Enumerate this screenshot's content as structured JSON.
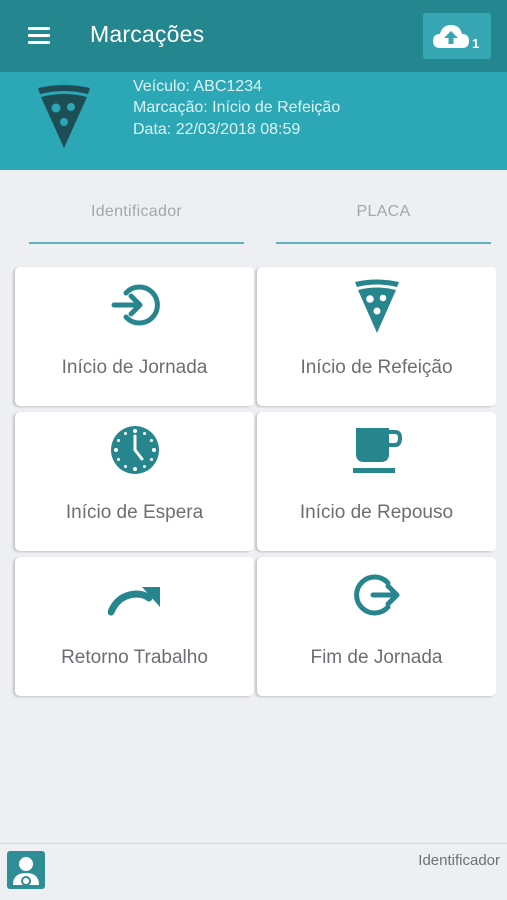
{
  "appbar": {
    "title": "Marcações",
    "upload_count": "1",
    "menu_icon": "menu-icon",
    "upload_icon": "cloud-upload-icon",
    "color": "#24868f"
  },
  "banner": {
    "icon": "pizza-slice-icon",
    "vehicle": "Veículo: ABC1234",
    "marking": "Marcação: Início de Refeição",
    "date": "Data: 22/03/2018 08:59",
    "color": "#2ba7b5"
  },
  "fields": {
    "identifier_placeholder": "Identificador",
    "plate_placeholder": "PLACA"
  },
  "actions": [
    {
      "label": "Início de Jornada",
      "icon": "login-arrow-icon"
    },
    {
      "label": "Início de Refeição",
      "icon": "pizza-slice-icon"
    },
    {
      "label": "Início de Espera",
      "icon": "clock-icon"
    },
    {
      "label": "Início de Repouso",
      "icon": "coffee-cup-icon"
    },
    {
      "label": "Retorno Trabalho",
      "icon": "redo-arrow-icon"
    },
    {
      "label": "Fim de Jornada",
      "icon": "logout-arrow-icon"
    }
  ],
  "footer": {
    "avatar_icon": "driver-avatar-icon",
    "label": "Identificador"
  },
  "colors": {
    "icon": "#27858e",
    "background": "#eeeff3"
  }
}
